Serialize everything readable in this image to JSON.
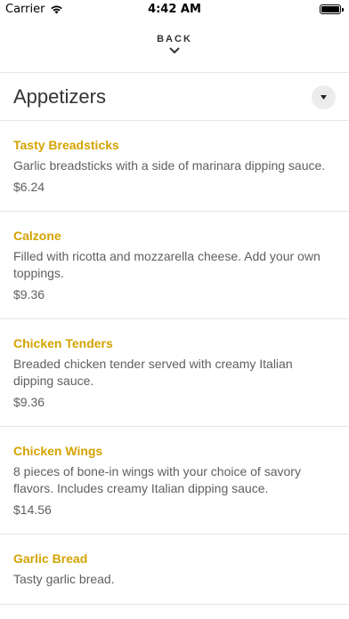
{
  "status_bar": {
    "carrier": "Carrier",
    "time": "4:42 AM",
    "icons": [
      "wifi-icon",
      "battery-icon"
    ]
  },
  "nav": {
    "back_label": "BACK",
    "back_icon": "chevron-down-icon"
  },
  "section": {
    "title": "Appetizers",
    "toggle_icon": "caret-down-icon"
  },
  "colors": {
    "item_name": "#d4a300",
    "text": "#5f5f5f",
    "divider": "#e6e6e6"
  },
  "items": [
    {
      "name": "Tasty Breadsticks",
      "description": "Garlic breadsticks with a side of marinara dipping sauce.",
      "price": "$6.24"
    },
    {
      "name": "Calzone",
      "description": "Filled with ricotta and mozzarella cheese. Add your own toppings.",
      "price": "$9.36"
    },
    {
      "name": "Chicken Tenders",
      "description": "Breaded chicken tender served with creamy Italian dipping sauce.",
      "price": "$9.36"
    },
    {
      "name": "Chicken Wings",
      "description": "8 pieces of bone-in wings with your choice of savory flavors. Includes creamy Italian dipping sauce.",
      "price": "$14.56"
    },
    {
      "name": "Garlic Bread",
      "description": "Tasty garlic bread.",
      "price": ""
    }
  ]
}
